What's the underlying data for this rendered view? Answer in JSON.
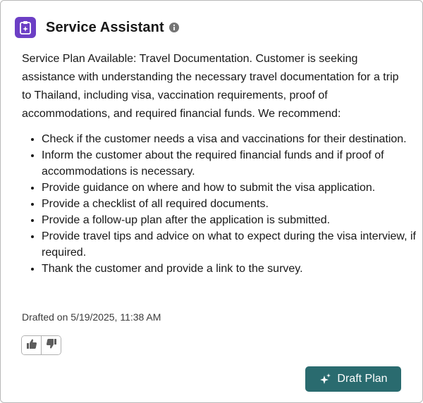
{
  "header": {
    "title": "Service Assistant",
    "app_icon": "clipboard-sparkle-icon",
    "info_icon": "info-icon",
    "accent_color": "#6c3fc5"
  },
  "summary": {
    "text": "Service Plan Available: Travel Documentation. Customer is seeking assistance with understanding the necessary travel documentation for a trip to Thailand, including visa, vaccination requirements, proof of accommodations, and required financial funds. We recommend:"
  },
  "recommendations": [
    "Check if the customer needs a visa and vaccinations for their destination.",
    "Inform the customer about the required financial funds and if proof of accommodations is necessary.",
    "Provide guidance on where and how to submit the visa application.",
    "Provide a checklist of all required documents.",
    "Provide a follow-up plan after the application is submitted.",
    "Provide travel tips and advice on what to expect during the visa interview, if required.",
    "Thank the customer and provide a link to the survey."
  ],
  "footer": {
    "timestamp": "Drafted on 5/19/2025, 11:38 AM",
    "thumbs_up_icon": "thumbs-up-icon",
    "thumbs_down_icon": "thumbs-down-icon",
    "draft_button_label": "Draft Plan",
    "draft_button_icon": "sparkle-icon",
    "button_color": "#2a6b6f"
  }
}
